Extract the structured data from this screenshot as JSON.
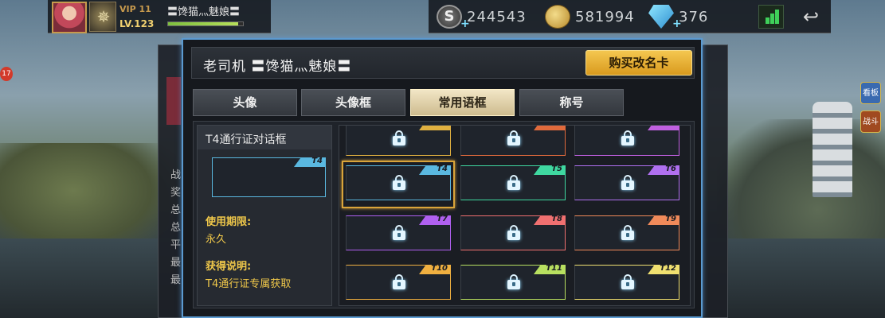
{
  "hud": {
    "vip": "VIP 11",
    "level": "LV.123",
    "player_name": "〓馋猫灬魅娘〓",
    "xp_fraction": 0.94,
    "rank_glyph": "✵"
  },
  "currency": {
    "silver_icon_letter": "S",
    "silver": "244543",
    "gold": "581994",
    "gems": "376",
    "plus": "+"
  },
  "back_glyph": "↩",
  "side_badge": "17",
  "side_icons": [
    "看板",
    "战斗"
  ],
  "dialog": {
    "title": "老司机 〓馋猫灬魅娘〓",
    "buy_button": "购买改名卡"
  },
  "tabs": [
    {
      "label": "头像",
      "active": false
    },
    {
      "label": "头像框",
      "active": false
    },
    {
      "label": "常用语框",
      "active": true
    },
    {
      "label": "称号",
      "active": false
    }
  ],
  "detail": {
    "title": "T4通行证对话框",
    "tag": "T4",
    "duration_label": "使用期限:",
    "duration_value": "永久",
    "obtain_label": "获得说明:",
    "obtain_value": "T4通行证专属获取"
  },
  "bg_labels": [
    "战",
    "奖",
    "总",
    "总",
    "平",
    "最",
    "最"
  ],
  "frames": [
    {
      "tag": "",
      "color": "#e0b040",
      "locked": true
    },
    {
      "tag": "",
      "color": "#e06a3c",
      "locked": true
    },
    {
      "tag": "",
      "color": "#c060e0",
      "locked": true
    },
    {
      "tag": "T4",
      "color": "#5ab8e0",
      "locked": true,
      "selected": true
    },
    {
      "tag": "T5",
      "color": "#3fd8a0",
      "locked": true
    },
    {
      "tag": "T6",
      "color": "#b070f0",
      "locked": true
    },
    {
      "tag": "T7",
      "color": "#b060f0",
      "locked": true
    },
    {
      "tag": "T8",
      "color": "#f07070",
      "locked": true
    },
    {
      "tag": "T9",
      "color": "#f08a5a",
      "locked": true
    },
    {
      "tag": "T10",
      "color": "#f0b040",
      "locked": true
    },
    {
      "tag": "T11",
      "color": "#b8e060",
      "locked": true
    },
    {
      "tag": "T12",
      "color": "#f0e070",
      "locked": true
    }
  ]
}
